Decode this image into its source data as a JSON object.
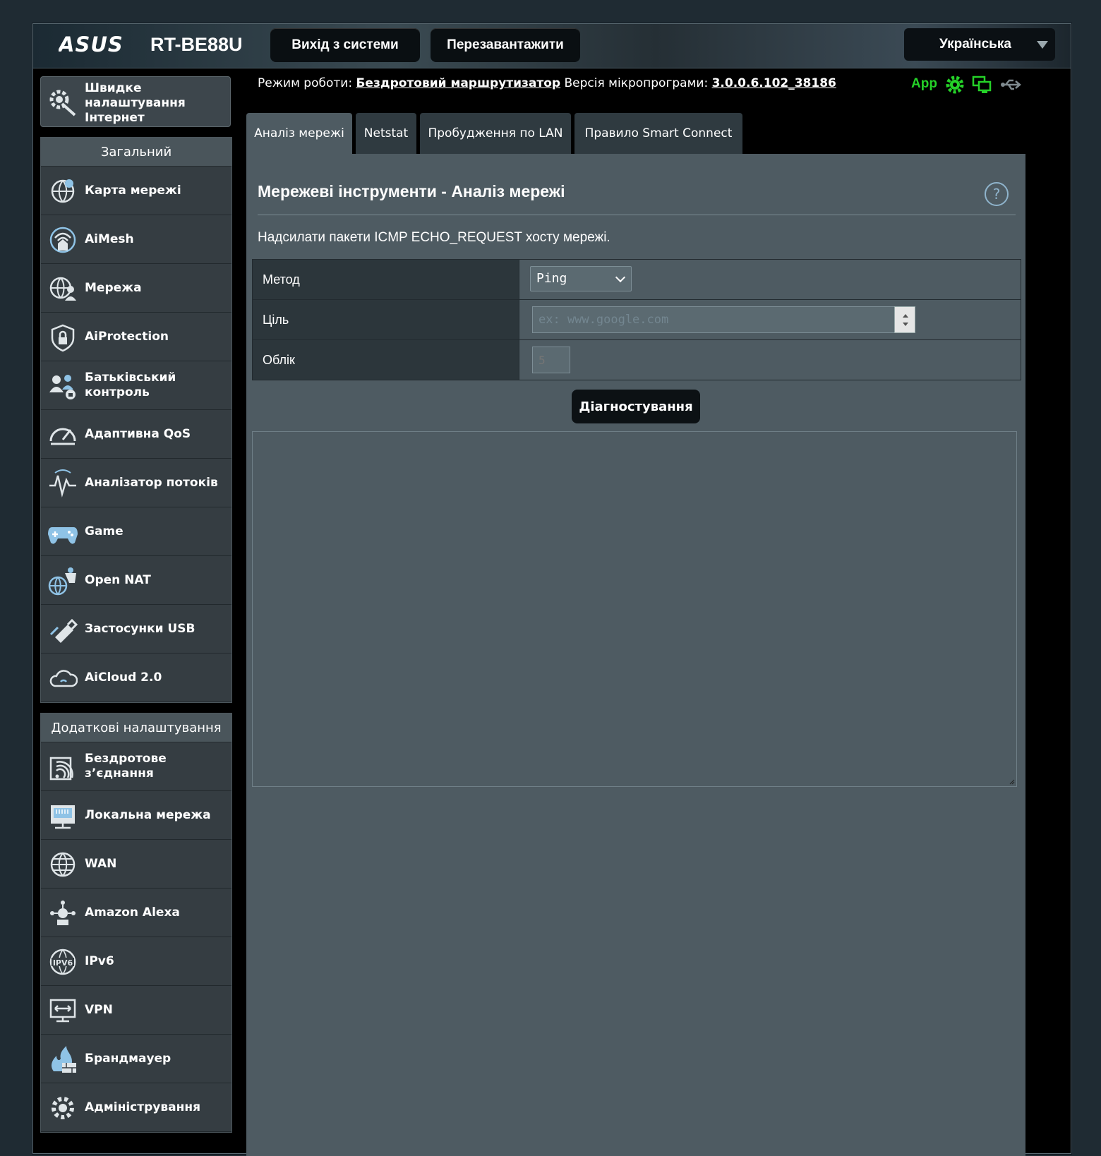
{
  "header": {
    "brand": "ASUS",
    "model": "RT-BE88U",
    "logout_label": "Вихід з системи",
    "reboot_label": "Перезавантажити",
    "language": "Українська"
  },
  "status": {
    "mode_prefix": "Режим роботи:",
    "mode_value": "Бездротовий маршрутизатор",
    "fw_prefix": "Версія мікропрограми:",
    "fw_value": "3.0.0.6.102_38186",
    "app_label": "App"
  },
  "sidebar": {
    "quick_setup": "Швидке налаштування Інтернет",
    "general_header": "Загальний",
    "general_items": [
      {
        "label": "Карта мережі",
        "icon": "network-map-icon"
      },
      {
        "label": "AiMesh",
        "icon": "aimesh-icon"
      },
      {
        "label": "Мережа",
        "icon": "guest-network-icon"
      },
      {
        "label": "AiProtection",
        "icon": "shield-icon"
      },
      {
        "label": "Батьківський контроль",
        "icon": "parental-control-icon"
      },
      {
        "label": "Адаптивна QoS",
        "icon": "qos-gauge-icon"
      },
      {
        "label": "Аналізатор потоків",
        "icon": "traffic-analyzer-icon"
      },
      {
        "label": "Game",
        "icon": "gamepad-icon"
      },
      {
        "label": "Open NAT",
        "icon": "open-nat-icon"
      },
      {
        "label": "Застосунки USB",
        "icon": "usb-icon"
      },
      {
        "label": "AiCloud 2.0",
        "icon": "cloud-icon"
      }
    ],
    "advanced_header": "Додаткові налаштування",
    "advanced_items": [
      {
        "label": "Бездротове з’єднання",
        "icon": "wireless-icon"
      },
      {
        "label": "Локальна мережа",
        "icon": "lan-icon"
      },
      {
        "label": "WAN",
        "icon": "globe-icon"
      },
      {
        "label": "Amazon Alexa",
        "icon": "alexa-icon"
      },
      {
        "label": "IPv6",
        "icon": "ipv6-icon"
      },
      {
        "label": "VPN",
        "icon": "vpn-icon"
      },
      {
        "label": "Брандмауер",
        "icon": "firewall-icon"
      },
      {
        "label": "Адміністрування",
        "icon": "admin-gear-icon"
      }
    ]
  },
  "tabs": [
    {
      "label": "Аналіз мережі",
      "active": true
    },
    {
      "label": "Netstat",
      "active": false
    },
    {
      "label": "Пробудження по LAN",
      "active": false
    },
    {
      "label": "Правило Smart Connect",
      "active": false
    }
  ],
  "main": {
    "title": "Мережеві інструменти - Аналіз мережі",
    "description": "Надсилати пакети ICMP ECHO_REQUEST хосту мережі.",
    "method_label": "Метод",
    "method_value": "Ping",
    "target_label": "Ціль",
    "target_placeholder": "ex: www.google.com",
    "count_label": "Облік",
    "count_placeholder": "5",
    "diagnose_label": "Діагностування",
    "output": ""
  },
  "colors": {
    "accent_green": "#25d228",
    "panel": "#4e5b62",
    "sidebar": "#353d42"
  }
}
